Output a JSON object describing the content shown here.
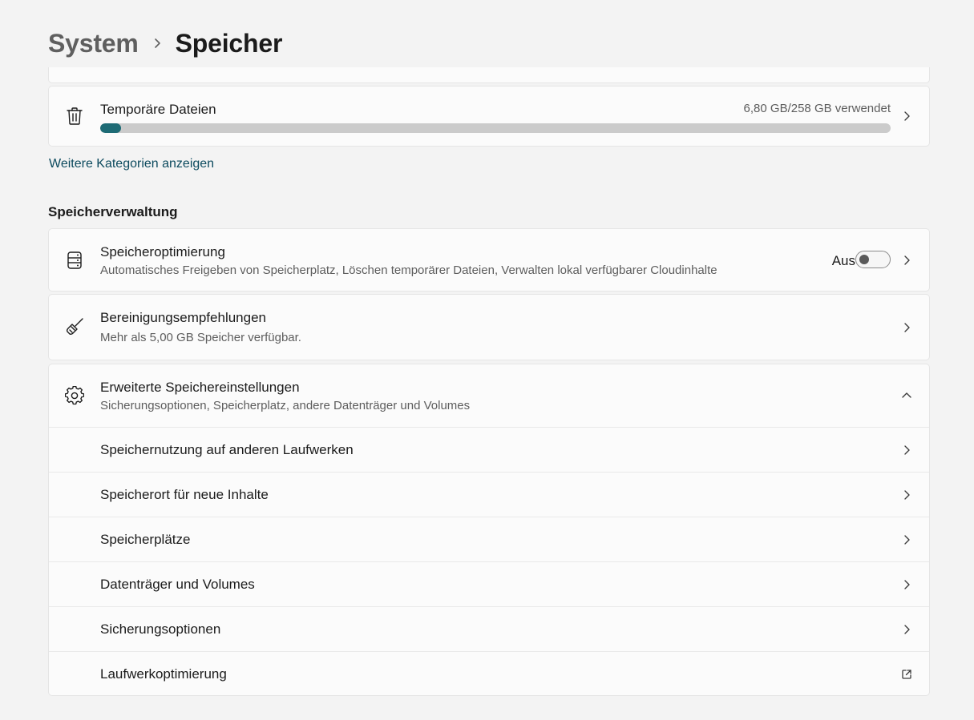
{
  "breadcrumb": {
    "parent": "System",
    "current": "Speicher"
  },
  "temp_files": {
    "title": "Temporäre Dateien",
    "usage": "6,80 GB/258 GB verwendet",
    "used_fraction": 0.026,
    "bar_color": "#1e6b75"
  },
  "more_link": "Weitere Kategorien anzeigen",
  "section": {
    "title": "Speicherverwaltung"
  },
  "storage_sense": {
    "title": "Speicheroptimierung",
    "subtitle": "Automatisches Freigeben von Speicherplatz, Löschen temporärer Dateien, Verwalten lokal verfügbarer Cloudinhalte",
    "toggle_label": "Aus",
    "toggle_on": false
  },
  "cleanup": {
    "title": "Bereinigungsempfehlungen",
    "subtitle": "Mehr als 5,00 GB Speicher verfügbar."
  },
  "advanced": {
    "title": "Erweiterte Speichereinstellungen",
    "subtitle": "Sicherungsoptionen, Speicherplatz, andere Datenträger und Volumes",
    "items": [
      {
        "label": "Speichernutzung auf anderen Laufwerken",
        "icon": "chevron-right-icon"
      },
      {
        "label": "Speicherort für neue Inhalte",
        "icon": "chevron-right-icon"
      },
      {
        "label": "Speicherplätze",
        "icon": "chevron-right-icon"
      },
      {
        "label": "Datenträger und Volumes",
        "icon": "chevron-right-icon"
      },
      {
        "label": "Sicherungsoptionen",
        "icon": "chevron-right-icon"
      },
      {
        "label": "Laufwerkoptimierung",
        "icon": "external-link-icon"
      }
    ]
  },
  "icons": {
    "trash": "trash-icon",
    "storage": "storage-icon",
    "broom": "broom-icon",
    "gear": "gear-icon"
  }
}
